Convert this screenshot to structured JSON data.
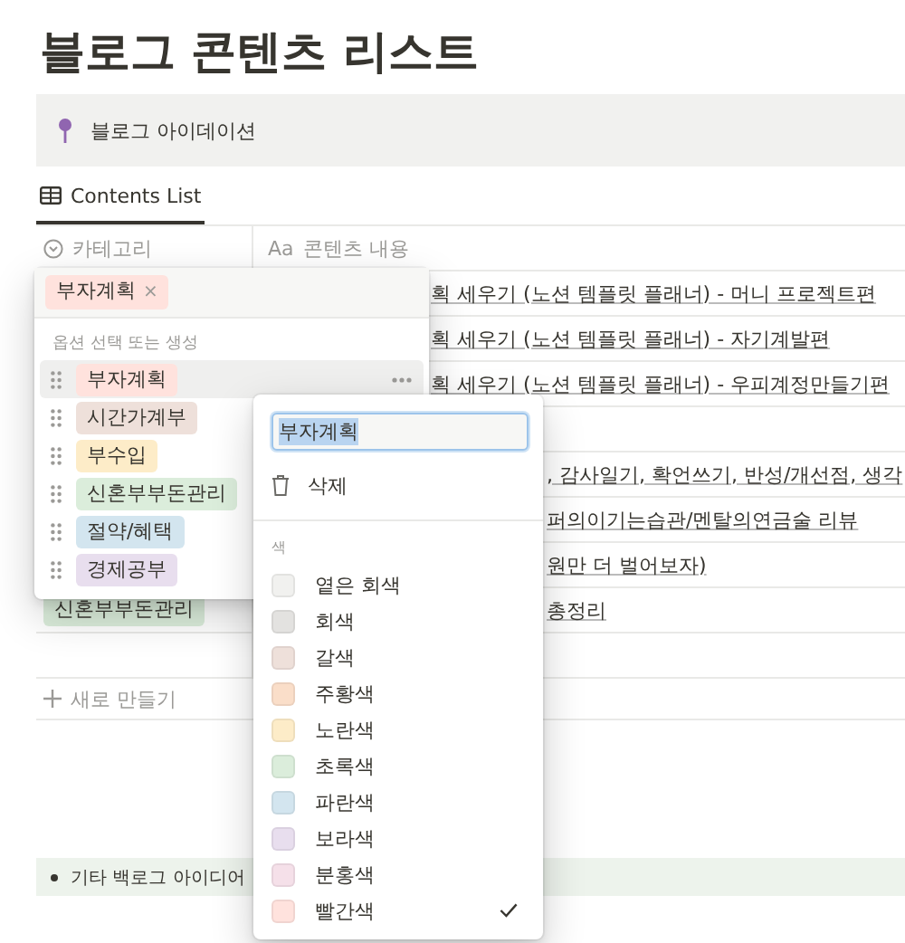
{
  "title": "블로그 콘텐츠 리스트",
  "callout": {
    "text": "블로그 아이데이션"
  },
  "view_tab": {
    "label": "Contents List",
    "selected": true
  },
  "table": {
    "columns": [
      {
        "label": "카테고리"
      },
      {
        "glyph": "Aa",
        "label": "콘텐츠 내용"
      }
    ],
    "rows": [
      {
        "content": "획 세우기 (노션 템플릿 플래너) - 머니 프로젝트편"
      },
      {
        "content": "획 세우기 (노션 템플릿 플래너) - 자기계발편"
      },
      {
        "content": "획 세우기 (노션 템플릿 플래너) - 우피계정만들기편"
      },
      {},
      {
        "content": ", 감사일기, 확언쓰기, 반성/개선점, 생각"
      },
      {
        "content": "퍼의이기는습관/멘탈의연금술 리뷰"
      },
      {
        "content": "원만 더 벌어보자)"
      },
      {
        "category": {
          "label": "신혼부부돈관리",
          "color": "#dbeddb"
        },
        "content": "총정리"
      },
      {}
    ],
    "new_row": "새로 만들기"
  },
  "dropdown": {
    "selected_tags": [
      {
        "label": "부자계획",
        "color": "#ffe2dd",
        "remove_glyph": "×"
      }
    ],
    "hint": "옵션 선택 또는 생성",
    "options": [
      {
        "label": "부자계획",
        "color": "#ffe2dd",
        "selected": true
      },
      {
        "label": "시간가계부",
        "color": "#eee0da",
        "selected": false
      },
      {
        "label": "부수입",
        "color": "#fdecc8",
        "selected": false
      },
      {
        "label": "신혼부부돈관리",
        "color": "#dbeddb",
        "selected": false
      },
      {
        "label": "절약/혜택",
        "color": "#d3e5ef",
        "selected": false
      },
      {
        "label": "경제공부",
        "color": "#e8deee",
        "selected": false
      }
    ]
  },
  "option_menu": {
    "name_value": "부자계획",
    "delete_label": "삭제",
    "color_heading": "색",
    "colors": [
      {
        "label": "옅은 회색",
        "color": "#f1f1ef",
        "selected": false
      },
      {
        "label": "회색",
        "color": "#e3e2e0",
        "selected": false
      },
      {
        "label": "갈색",
        "color": "#eee0da",
        "selected": false
      },
      {
        "label": "주황색",
        "color": "#fadec9",
        "selected": false
      },
      {
        "label": "노란색",
        "color": "#fdecc8",
        "selected": false
      },
      {
        "label": "초록색",
        "color": "#dbeddb",
        "selected": false
      },
      {
        "label": "파란색",
        "color": "#d3e5ef",
        "selected": false
      },
      {
        "label": "보라색",
        "color": "#e8deee",
        "selected": false
      },
      {
        "label": "분홍색",
        "color": "#f5e0e9",
        "selected": false
      },
      {
        "label": "빨간색",
        "color": "#ffe2dd",
        "selected": true
      }
    ]
  },
  "bullet": {
    "text": "기타 백로그 아이디어"
  }
}
